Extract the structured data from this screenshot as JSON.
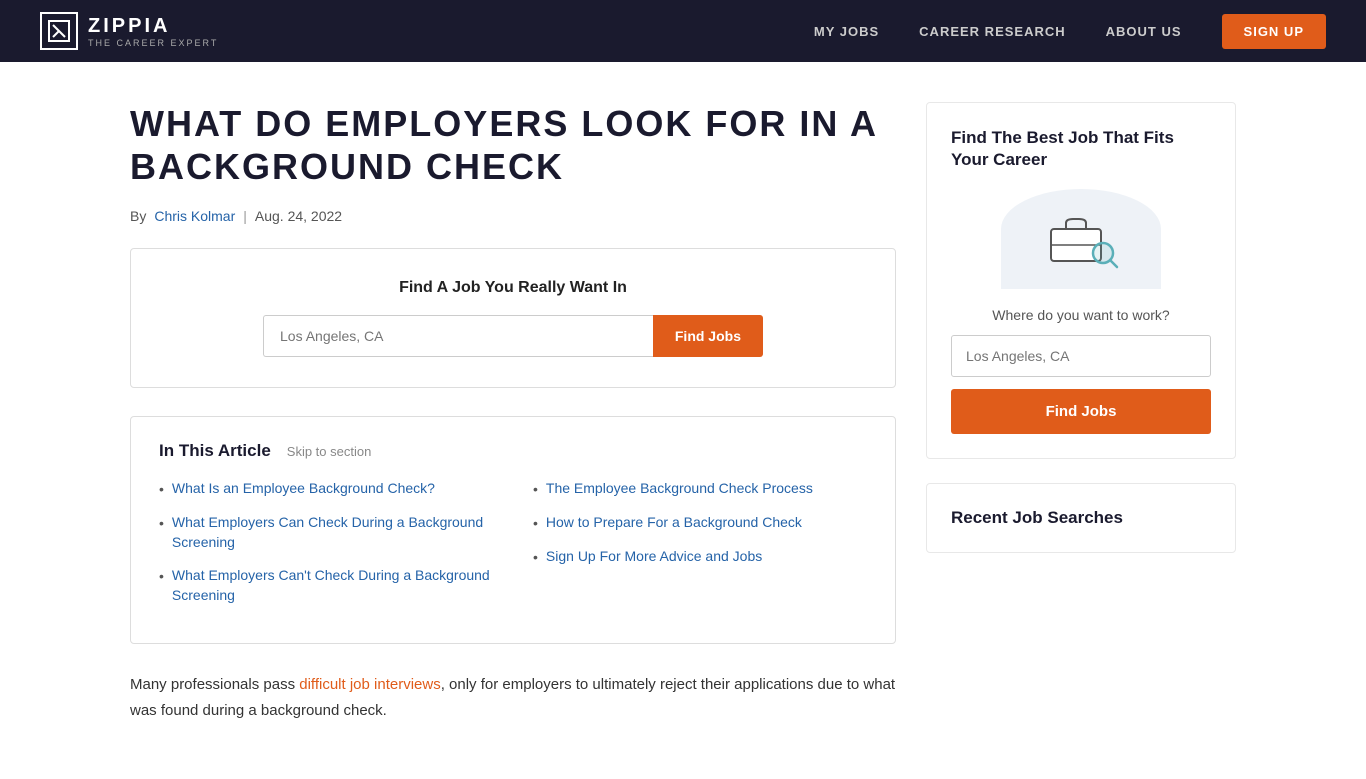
{
  "header": {
    "logo_icon": "Z",
    "logo_name": "ZIPPIA",
    "logo_tagline": "THE CAREER EXPERT",
    "nav_items": [
      {
        "id": "my-jobs",
        "label": "MY JOBS"
      },
      {
        "id": "career-research",
        "label": "CAREER RESEARCH"
      },
      {
        "id": "about-us",
        "label": "ABOUT US"
      }
    ],
    "signup_label": "SIGN UP"
  },
  "article": {
    "title": "WHAT DO EMPLOYERS LOOK FOR IN A BACKGROUND CHECK",
    "meta_by": "By",
    "author": "Chris Kolmar",
    "date": "Aug. 24, 2022"
  },
  "job_search_top": {
    "title": "Find A Job You Really Want In",
    "placeholder": "Los Angeles, CA",
    "button_label": "Find Jobs"
  },
  "toc": {
    "title": "In This Article",
    "skip_label": "Skip to section",
    "left_items": [
      {
        "text": "What Is an Employee Background Check?"
      },
      {
        "text": "What Employers Can Check During a Background Screening"
      },
      {
        "text": "What Employers Can't Check During a Background Screening"
      }
    ],
    "right_items": [
      {
        "text": "The Employee Background Check Process"
      },
      {
        "text": "How to Prepare For a Background Check"
      },
      {
        "text": "Sign Up For More Advice and Jobs"
      }
    ]
  },
  "article_body": {
    "paragraph1_start": "Many professionals pass ",
    "paragraph1_link": "difficult job interviews",
    "paragraph1_end": ", only for employers to ultimately reject their applications due to what was found during a background check."
  },
  "sidebar": {
    "card1": {
      "title": "Find The Best Job That Fits Your Career",
      "where_label": "Where do you want to work?",
      "placeholder": "Los Angeles, CA",
      "button_label": "Find Jobs"
    },
    "card2": {
      "title": "Recent Job Searches"
    }
  }
}
